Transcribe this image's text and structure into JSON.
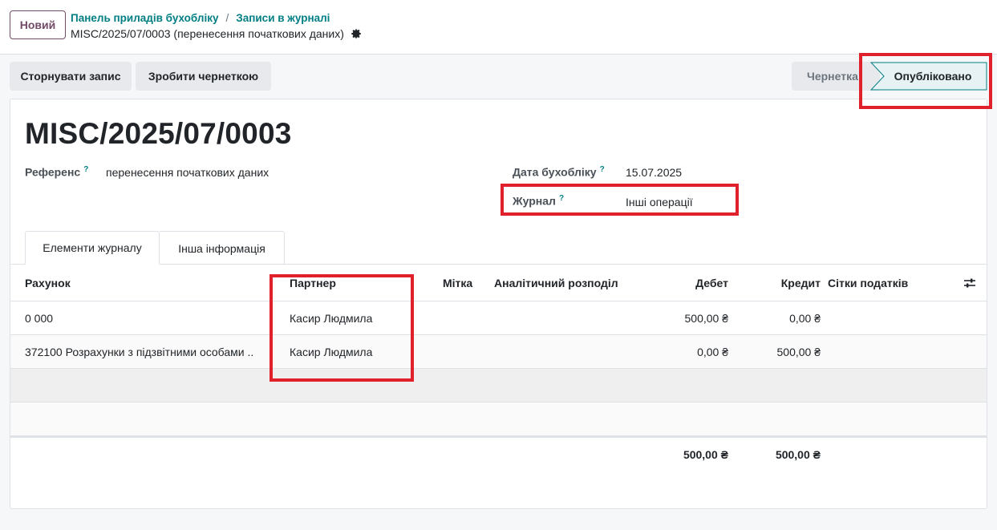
{
  "control_panel": {
    "new_button": "Новий",
    "breadcrumb": [
      "Панель приладів бухобліку",
      "Записи в журналі"
    ],
    "breadcrumb_separator": "/",
    "record_name": "MISC/2025/07/0003 (перенесення початкових даних)",
    "record_settings_icon": "gear-icon"
  },
  "statusbar": {
    "reverse_button": "Сторнувати запис",
    "draft_button": "Зробити чернеткою",
    "stages": [
      "Чернетка",
      "Опубліковано"
    ],
    "active_stage": "Опубліковано"
  },
  "form": {
    "title": "MISC/2025/07/0003",
    "reference_label": "Референс",
    "reference_value": "перенесення початкових даних",
    "date_label": "Дата бухобліку",
    "date_value": "15.07.2025",
    "journal_label": "Журнал",
    "journal_value": "Інші операції",
    "help_mark": "?"
  },
  "tabs": [
    "Елементи журналу",
    "Інша інформація"
  ],
  "lines_table": {
    "columns": {
      "account": "Рахунок",
      "partner": "Партнер",
      "label": "Мітка",
      "analytic": "Аналітичний розподіл",
      "debit": "Дебет",
      "credit": "Кредит",
      "tax_grids": "Сітки податків"
    },
    "rows": [
      {
        "account": "0 000",
        "partner": "Касир Людмила",
        "label": "",
        "analytic": "",
        "debit": "500,00 ₴",
        "credit": "0,00 ₴",
        "tax_grids": ""
      },
      {
        "account": "372100 Розрахунки з підзвітними особами ..",
        "partner": "Касир Людмила",
        "label": "",
        "analytic": "",
        "debit": "0,00 ₴",
        "credit": "500,00 ₴",
        "tax_grids": ""
      }
    ],
    "totals": {
      "debit": "500,00 ₴",
      "credit": "500,00 ₴"
    }
  },
  "colors": {
    "brand": "#714b67",
    "link": "#017e84",
    "highlight": "#e0202a"
  }
}
